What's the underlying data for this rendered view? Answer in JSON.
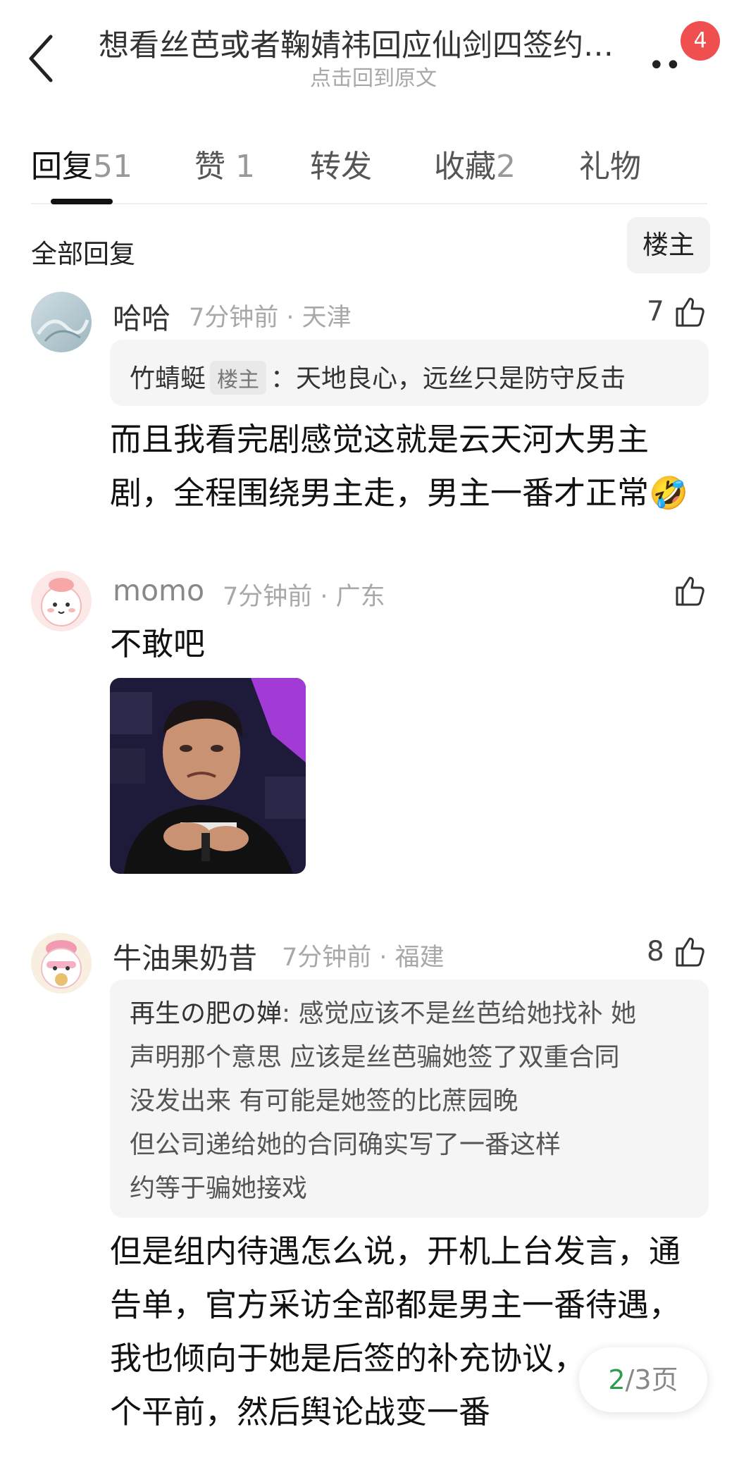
{
  "header": {
    "title": "想看丝芭或者鞠婧祎回应仙剑四签约…",
    "subtitle": "点击回到原文",
    "more_glyph": "••",
    "notification_count": "4"
  },
  "tabs": [
    {
      "label": "回复",
      "count": "51"
    },
    {
      "label": "赞",
      "count": "1"
    },
    {
      "label": "转发",
      "count": ""
    },
    {
      "label": "收藏",
      "count": "2"
    },
    {
      "label": "礼物",
      "count": ""
    }
  ],
  "section": {
    "title": "全部回复",
    "filter_label": "楼主"
  },
  "comments": [
    {
      "name": "哈哈",
      "meta": "7分钟前 · 天津",
      "likes": "7",
      "quote": {
        "author": "竹蜻蜓",
        "tag": "楼主",
        "text": "：天地良心，远丝只是防守反击"
      },
      "body_lines": [
        "而且我看完剧感觉这就是云天河大男主",
        "剧，全程围绕男主走，男主一番才正常🤣"
      ]
    },
    {
      "name": "momo",
      "meta": "7分钟前 · 广东",
      "likes": "",
      "body_lines": [
        "不敢吧"
      ],
      "image": "meme-crying-man-photo"
    },
    {
      "name": "牛油果奶昔",
      "meta": "7分钟前 · 福建",
      "likes": "8",
      "quote": {
        "author": "再生の肥の婵",
        "lines": [
          ": 感觉应该不是丝芭给她找补 她",
          "声明那个意思 应该是丝芭骗她签了双重合同",
          "没发出来 有可能是她签的比蔗园晚",
          "但公司递给她的合同确实写了一番这样",
          "约等于骗她接戏"
        ]
      },
      "body_lines": [
        "但是组内待遇怎么说，开机上台发言，通",
        "告单，官方采访全部都是男主一番待遇，",
        "我也倾向于她是后签的补充协议，",
        "个平前，然后舆论战变一番"
      ]
    }
  ],
  "pager": {
    "current": "2",
    "total_text": "/3页"
  },
  "colors": {
    "accent_green": "#2e9b4f",
    "badge_red": "#ef4f4f",
    "muted": "#a8a8a8"
  }
}
